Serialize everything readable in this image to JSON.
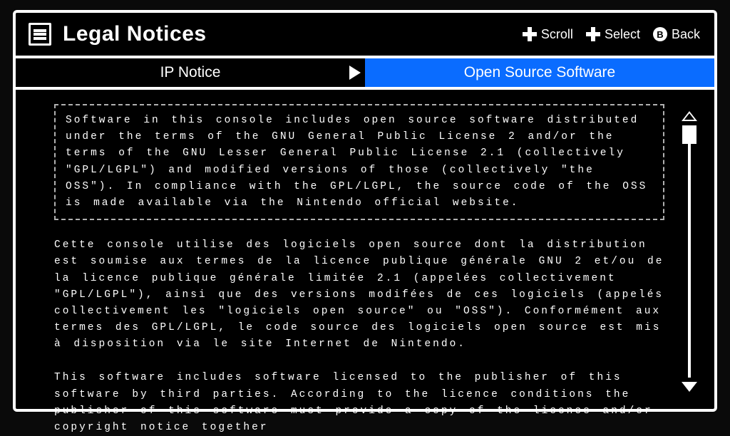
{
  "header": {
    "title": "Legal Notices",
    "hints": {
      "scroll": "Scroll",
      "select": "Select",
      "back_letter": "B",
      "back": "Back"
    }
  },
  "tabs": {
    "ip_notice": "IP Notice",
    "open_source": "Open Source Software"
  },
  "content": {
    "p1": "Software in this console includes open source software distributed under the terms of the GNU General Public License 2 and/or the terms of the GNU Lesser General Public License 2.1 (collectively \"GPL/LGPL\") and modified versions of those (collectively \"the OSS\"). In compliance with the GPL/LGPL, the source code of the OSS is made available via the Nintendo official website.",
    "p2": "Cette console utilise des logiciels open source dont la distribution est soumise aux termes de la licence publique générale GNU 2 et/ou de la licence publique générale limitée 2.1 (appelées collectivement \"GPL/LGPL\"), ainsi que des versions modifées de ces logiciels (appelés collectivement les \"logiciels open source\" ou \"OSS\"). Conformément aux termes des GPL/LGPL, le code source des logiciels open source est mis à disposition via le site Internet de Nintendo.",
    "p3": "This software includes software licensed to the publisher of this software by third parties. According to the licence conditions the publisher of this software must provide a copy of the licence and/or copyright notice together"
  }
}
